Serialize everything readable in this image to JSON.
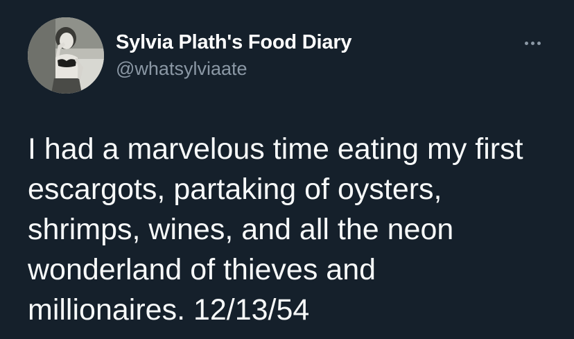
{
  "author": {
    "display_name": "Sylvia Plath's Food Diary",
    "handle": "@whatsylviaate",
    "avatar_icon": "profile-photo-woman-eating"
  },
  "actions": {
    "more_icon": "more-horizontal-icon"
  },
  "tweet": {
    "lines": [
      "I had a marvelous time eating my first",
      "escargots, partaking of oysters,",
      "shrimps, wines, and all the neon",
      "wonderland of thieves and",
      "millionaires. 12/13/54"
    ]
  },
  "colors": {
    "background": "#15202b",
    "primary_text": "#ffffff",
    "secondary_text": "#8b98a5"
  }
}
